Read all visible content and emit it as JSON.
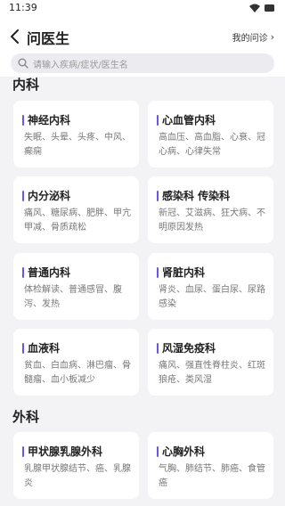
{
  "status": {
    "time": "11:39"
  },
  "header": {
    "title": "问医生",
    "my_consult": "我的问诊",
    "chevron": "›"
  },
  "search": {
    "placeholder": "请输入疾病/症状/医生名"
  },
  "sections": [
    {
      "title": "内科",
      "cards": [
        {
          "title": "神经内科",
          "desc": "失眠、头晕、头疼、中风、癫痫"
        },
        {
          "title": "心血管内科",
          "desc": "高血压、高血脂、心衰、冠心病、心律失常"
        },
        {
          "title": "内分泌科",
          "desc": "痛风、糖尿病、肥胖、甲亢甲减、骨质疏松"
        },
        {
          "title": "感染科 传染科",
          "desc": "新冠、艾滋病、狂犬病、不明原因发热"
        },
        {
          "title": "普通内科",
          "desc": "体检解读、普通感冒、腹泻、发热"
        },
        {
          "title": "肾脏内科",
          "desc": "肾炎、血尿、蛋白尿、尿路感染"
        },
        {
          "title": "血液科",
          "desc": "贫血、白血病、淋巴瘤、骨髓瘤、血小板减少"
        },
        {
          "title": "风湿免疫科",
          "desc": "痛风、强直性脊柱炎、红斑狼疮、类风湿"
        }
      ]
    },
    {
      "title": "外科",
      "cards": [
        {
          "title": "甲状腺乳腺外科",
          "desc": "乳腺甲状腺结节、癌、乳腺炎"
        },
        {
          "title": "心胸外科",
          "desc": "气胸、肺结节、肺癌、食管癌"
        }
      ]
    }
  ],
  "colors": {
    "accent": "#6b55e6",
    "background": "#f3f3f5",
    "card": "#ffffff"
  }
}
